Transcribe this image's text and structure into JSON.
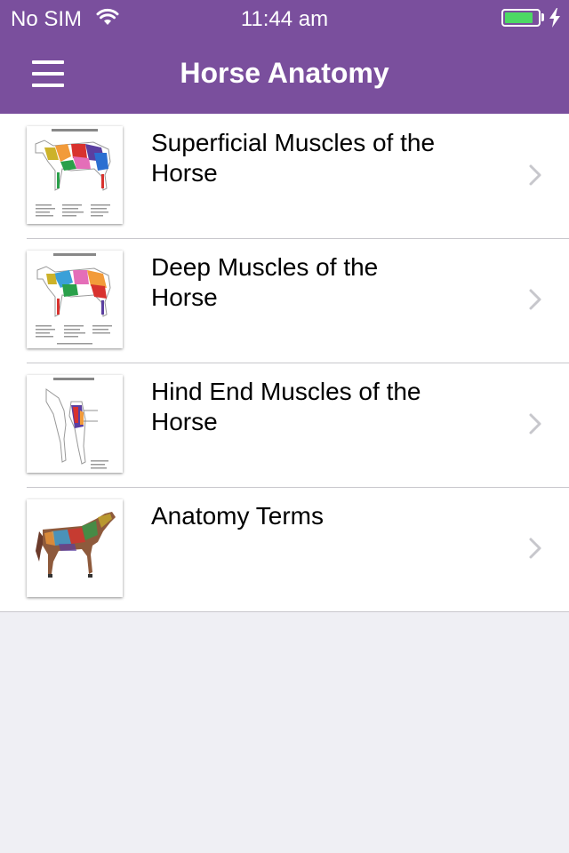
{
  "status_bar": {
    "carrier": "No SIM",
    "time": "11:44 am",
    "battery_level": 0.85,
    "icons": [
      "wifi-icon",
      "battery-icon",
      "charging-bolt-icon"
    ]
  },
  "nav": {
    "title": "Horse Anatomy",
    "menu_icon": "hamburger-menu-icon"
  },
  "items": [
    {
      "label": "Superficial Muscles of the Horse",
      "thumbnail": "superficial-muscles-diagram"
    },
    {
      "label": "Deep Muscles of the Horse",
      "thumbnail": "deep-muscles-diagram"
    },
    {
      "label": "Hind End Muscles of the Horse",
      "thumbnail": "hind-end-muscles-diagram"
    },
    {
      "label": "Anatomy Terms",
      "thumbnail": "painted-horse-photo"
    }
  ],
  "colors": {
    "header": "#7a4f9d",
    "background": "#efeff4",
    "separator": "#c8c7cc",
    "chevron": "#c7c7cc",
    "battery": "#4cd964"
  }
}
